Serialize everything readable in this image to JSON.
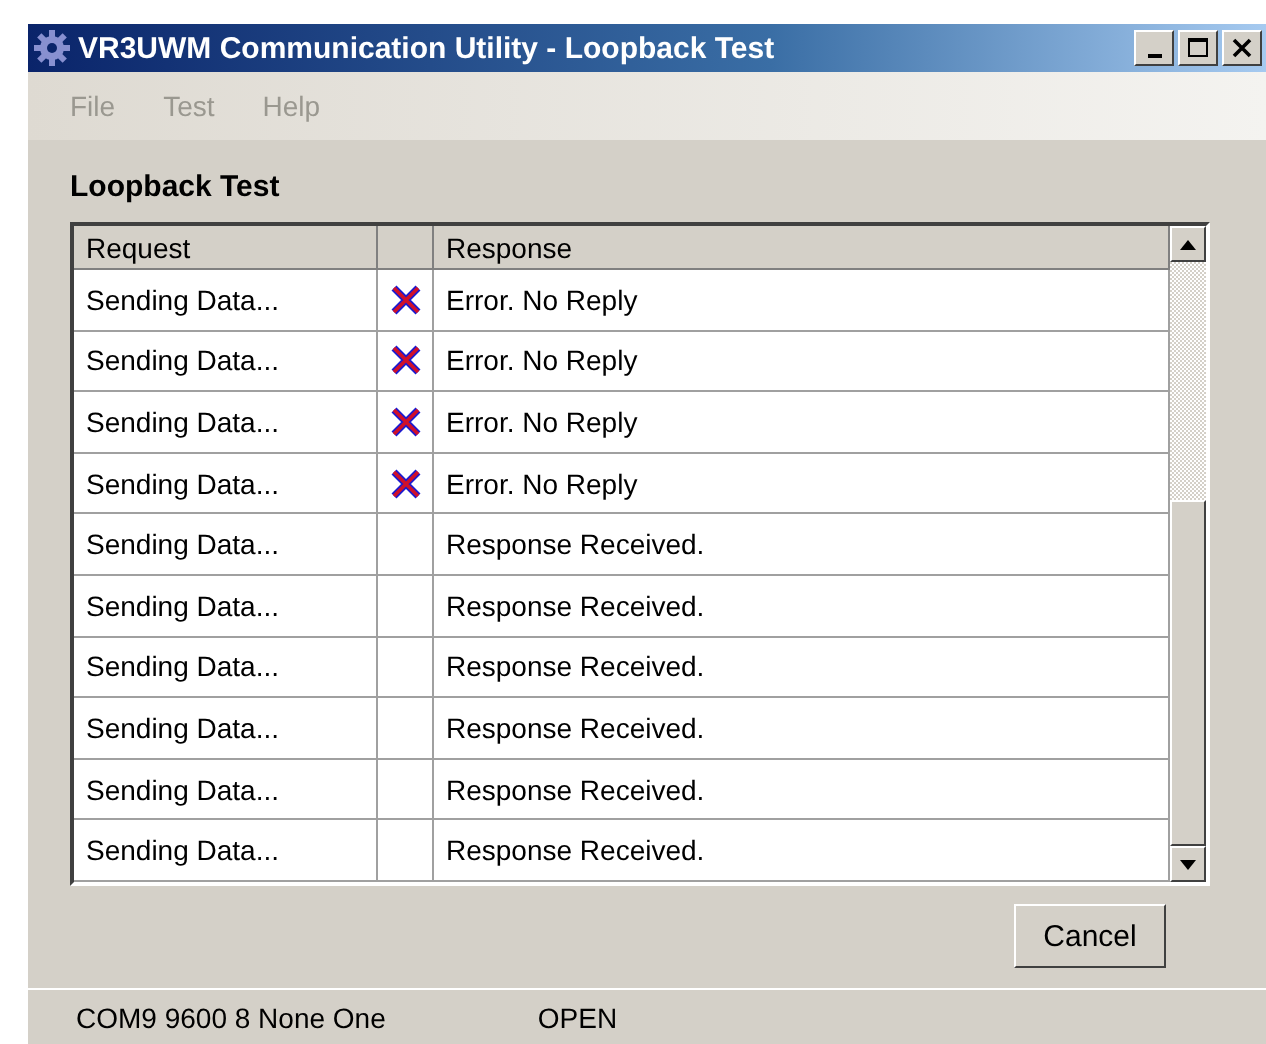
{
  "window": {
    "title": "VR3UWM Communication Utility - Loopback Test"
  },
  "menu": [
    {
      "label": "File",
      "disabled": true
    },
    {
      "label": "Test",
      "disabled": true
    },
    {
      "label": "Help",
      "disabled": true
    }
  ],
  "heading": "Loopback Test",
  "table": {
    "columns": [
      "Request",
      "Response"
    ],
    "rows": [
      {
        "request": "Sending Data...",
        "kind": "error",
        "response": "Error. No Reply"
      },
      {
        "request": "Sending Data...",
        "kind": "error",
        "response": "Error. No Reply"
      },
      {
        "request": "Sending Data...",
        "kind": "error",
        "response": "Error. No Reply"
      },
      {
        "request": "Sending Data...",
        "kind": "error",
        "response": "Error. No Reply"
      },
      {
        "request": "Sending Data...",
        "kind": "ok",
        "response": "Response Received."
      },
      {
        "request": "Sending Data...",
        "kind": "ok",
        "response": "Response Received."
      },
      {
        "request": "Sending Data...",
        "kind": "ok",
        "response": "Response Received."
      },
      {
        "request": "Sending Data...",
        "kind": "ok",
        "response": "Response Received."
      },
      {
        "request": "Sending Data...",
        "kind": "ok",
        "response": "Response Received."
      },
      {
        "request": "Sending Data...",
        "kind": "ok",
        "response": "Response Received."
      }
    ]
  },
  "buttons": [
    "Cancel"
  ],
  "status_bar": [
    "COM9 9600 8 None One",
    "OPEN"
  ]
}
